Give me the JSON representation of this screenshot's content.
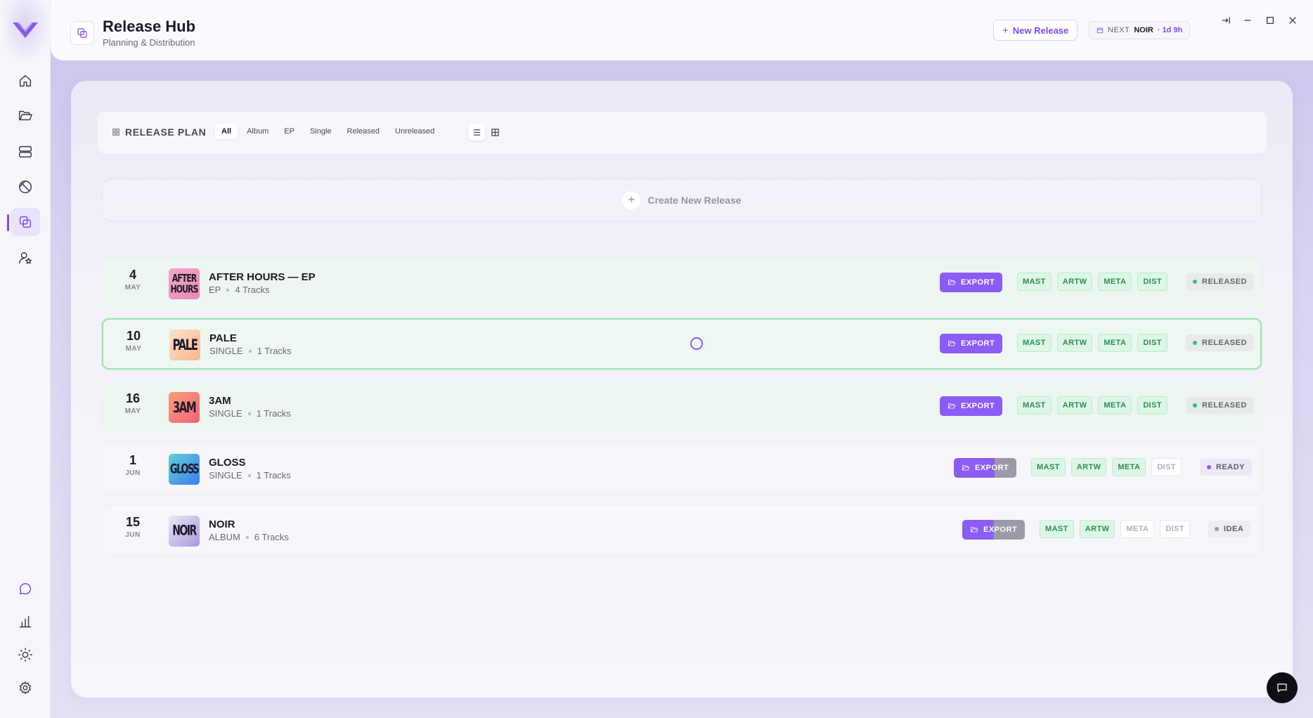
{
  "header": {
    "title": "Release Hub",
    "subtitle": "Planning & Distribution",
    "new_release_label": "New Release",
    "next_label": "NEXT",
    "next_name": "NOIR",
    "next_time": "· 1d 9h"
  },
  "sidebar": {
    "items": [
      {
        "name": "home-icon"
      },
      {
        "name": "folder-icon"
      },
      {
        "name": "server-icon"
      },
      {
        "name": "disabled-icon"
      },
      {
        "name": "releases-icon",
        "active": true
      },
      {
        "name": "user-star-icon"
      }
    ],
    "bottom_items": [
      {
        "name": "chat-icon"
      },
      {
        "name": "bar-chart-icon"
      },
      {
        "name": "sun-icon"
      },
      {
        "name": "gear-icon"
      }
    ]
  },
  "toolbar": {
    "title": "RELEASE PLAN",
    "filters": [
      "All",
      "Album",
      "EP",
      "Single",
      "Released",
      "Unreleased"
    ],
    "active_filter": "All"
  },
  "create": {
    "label": "Create New Release"
  },
  "releases": [
    {
      "day": "4",
      "month": "MAY",
      "cover_text": "AFTER HOURS",
      "title": "AFTER HOURS — EP",
      "type": "EP",
      "tracks": "4 Tracks",
      "export_label": "EXPORT",
      "steps": [
        {
          "label": "MAST",
          "done": true
        },
        {
          "label": "ARTW",
          "done": true
        },
        {
          "label": "META",
          "done": true
        },
        {
          "label": "DIST",
          "done": true
        }
      ],
      "status": "RELEASED"
    },
    {
      "day": "10",
      "month": "MAY",
      "cover_text": "PALE",
      "title": "PALE",
      "type": "SINGLE",
      "tracks": "1 Tracks",
      "export_label": "EXPORT",
      "steps": [
        {
          "label": "MAST",
          "done": true
        },
        {
          "label": "ARTW",
          "done": true
        },
        {
          "label": "META",
          "done": true
        },
        {
          "label": "DIST",
          "done": true
        }
      ],
      "status": "RELEASED"
    },
    {
      "day": "16",
      "month": "MAY",
      "cover_text": "3AM",
      "title": "3AM",
      "type": "SINGLE",
      "tracks": "1 Tracks",
      "export_label": "EXPORT",
      "steps": [
        {
          "label": "MAST",
          "done": true
        },
        {
          "label": "ARTW",
          "done": true
        },
        {
          "label": "META",
          "done": true
        },
        {
          "label": "DIST",
          "done": true
        }
      ],
      "status": "RELEASED"
    },
    {
      "day": "1",
      "month": "JUN",
      "cover_text": "GLOSS",
      "title": "GLOSS",
      "type": "SINGLE",
      "tracks": "1 Tracks",
      "export_label": "EXPORT",
      "steps": [
        {
          "label": "MAST",
          "done": true
        },
        {
          "label": "ARTW",
          "done": true
        },
        {
          "label": "META",
          "done": true
        },
        {
          "label": "DIST",
          "done": false
        }
      ],
      "status": "READY"
    },
    {
      "day": "15",
      "month": "JUN",
      "cover_text": "NOIR",
      "title": "NOIR",
      "type": "ALBUM",
      "tracks": "6 Tracks",
      "export_label": "EXPORT",
      "steps": [
        {
          "label": "MAST",
          "done": true
        },
        {
          "label": "ARTW",
          "done": true
        },
        {
          "label": "META",
          "done": false
        },
        {
          "label": "DIST",
          "done": false
        }
      ],
      "status": "IDEA"
    }
  ],
  "colors": {
    "accent": "#8b5cf6",
    "done_step": "#2f8a4f",
    "released_dot": "#34c26a"
  }
}
